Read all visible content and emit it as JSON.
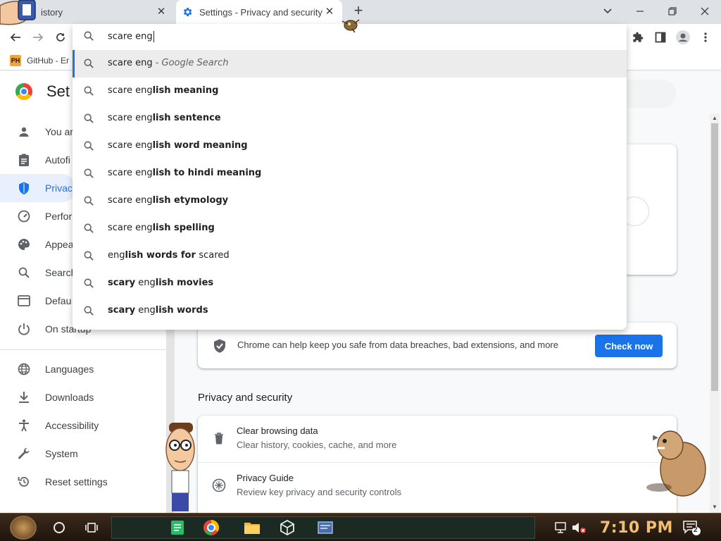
{
  "tabs": [
    {
      "title": "istory",
      "active": false
    },
    {
      "title": "Settings - Privacy and security",
      "active": true
    }
  ],
  "tab_close_glyph": "✕",
  "new_tab_glyph": "+",
  "bookmark": {
    "icon_text": "PH",
    "label": "GitHub - Er"
  },
  "omnibox": {
    "query": "scare eng",
    "suggestions": [
      {
        "plain": "scare eng",
        "rest": "",
        "suffix": " - Google Search"
      },
      {
        "plain": "scare eng",
        "rest": "lish meaning",
        "suffix": ""
      },
      {
        "plain": "scare eng",
        "rest": "lish sentence",
        "suffix": ""
      },
      {
        "plain": "scare eng",
        "rest": "lish word meaning",
        "suffix": ""
      },
      {
        "plain": "scare eng",
        "rest": "lish to hindi meaning",
        "suffix": ""
      },
      {
        "plain": "scare eng",
        "rest": "lish etymology",
        "suffix": ""
      },
      {
        "plain": "scare eng",
        "rest": "lish spelling",
        "suffix": ""
      },
      {
        "plain": "eng",
        "rest": "lish words for ",
        "tail": "scared",
        "suffix": ""
      },
      {
        "bold_start": "scary",
        "plain": " eng",
        "rest": "lish movies",
        "suffix": ""
      },
      {
        "bold_start": "scary",
        "plain": " eng",
        "rest": "lish words",
        "suffix": ""
      }
    ]
  },
  "sidebar": {
    "title": "Set",
    "items": [
      {
        "label": "You ar",
        "icon": "person-icon"
      },
      {
        "label": "Autofi",
        "icon": "clipboard-icon"
      },
      {
        "label": "Privac",
        "icon": "shield-icon",
        "selected": true
      },
      {
        "label": "Perfor",
        "icon": "speedometer-icon"
      },
      {
        "label": "Appea",
        "icon": "palette-icon"
      },
      {
        "label": "Search",
        "icon": "search-icon"
      },
      {
        "label": "Defau",
        "icon": "browser-icon"
      },
      {
        "label": "On startup",
        "icon": "power-icon"
      },
      {
        "label": "Languages",
        "icon": "globe-icon"
      },
      {
        "label": "Downloads",
        "icon": "download-icon"
      },
      {
        "label": "Accessibility",
        "icon": "accessibility-icon"
      },
      {
        "label": "System",
        "icon": "wrench-icon"
      },
      {
        "label": "Reset settings",
        "icon": "reset-icon"
      }
    ]
  },
  "safety_check": {
    "text": "Chrome can help keep you safe from data breaches, bad extensions, and more",
    "button": "Check now"
  },
  "privacy_section": {
    "title": "Privacy and security",
    "rows": [
      {
        "title": "Clear browsing data",
        "subtitle": "Clear history, cookies, cache, and more",
        "icon": "trash-icon"
      },
      {
        "title": "Privacy Guide",
        "subtitle": "Review key privacy and security controls",
        "icon": "compass-icon"
      }
    ]
  },
  "taskbar": {
    "clock": "7:10 PM",
    "notification_count": "2"
  },
  "colors": {
    "accent": "#1a73e8",
    "tabstrip": "#dee1e6",
    "clock": "#f0c070"
  }
}
